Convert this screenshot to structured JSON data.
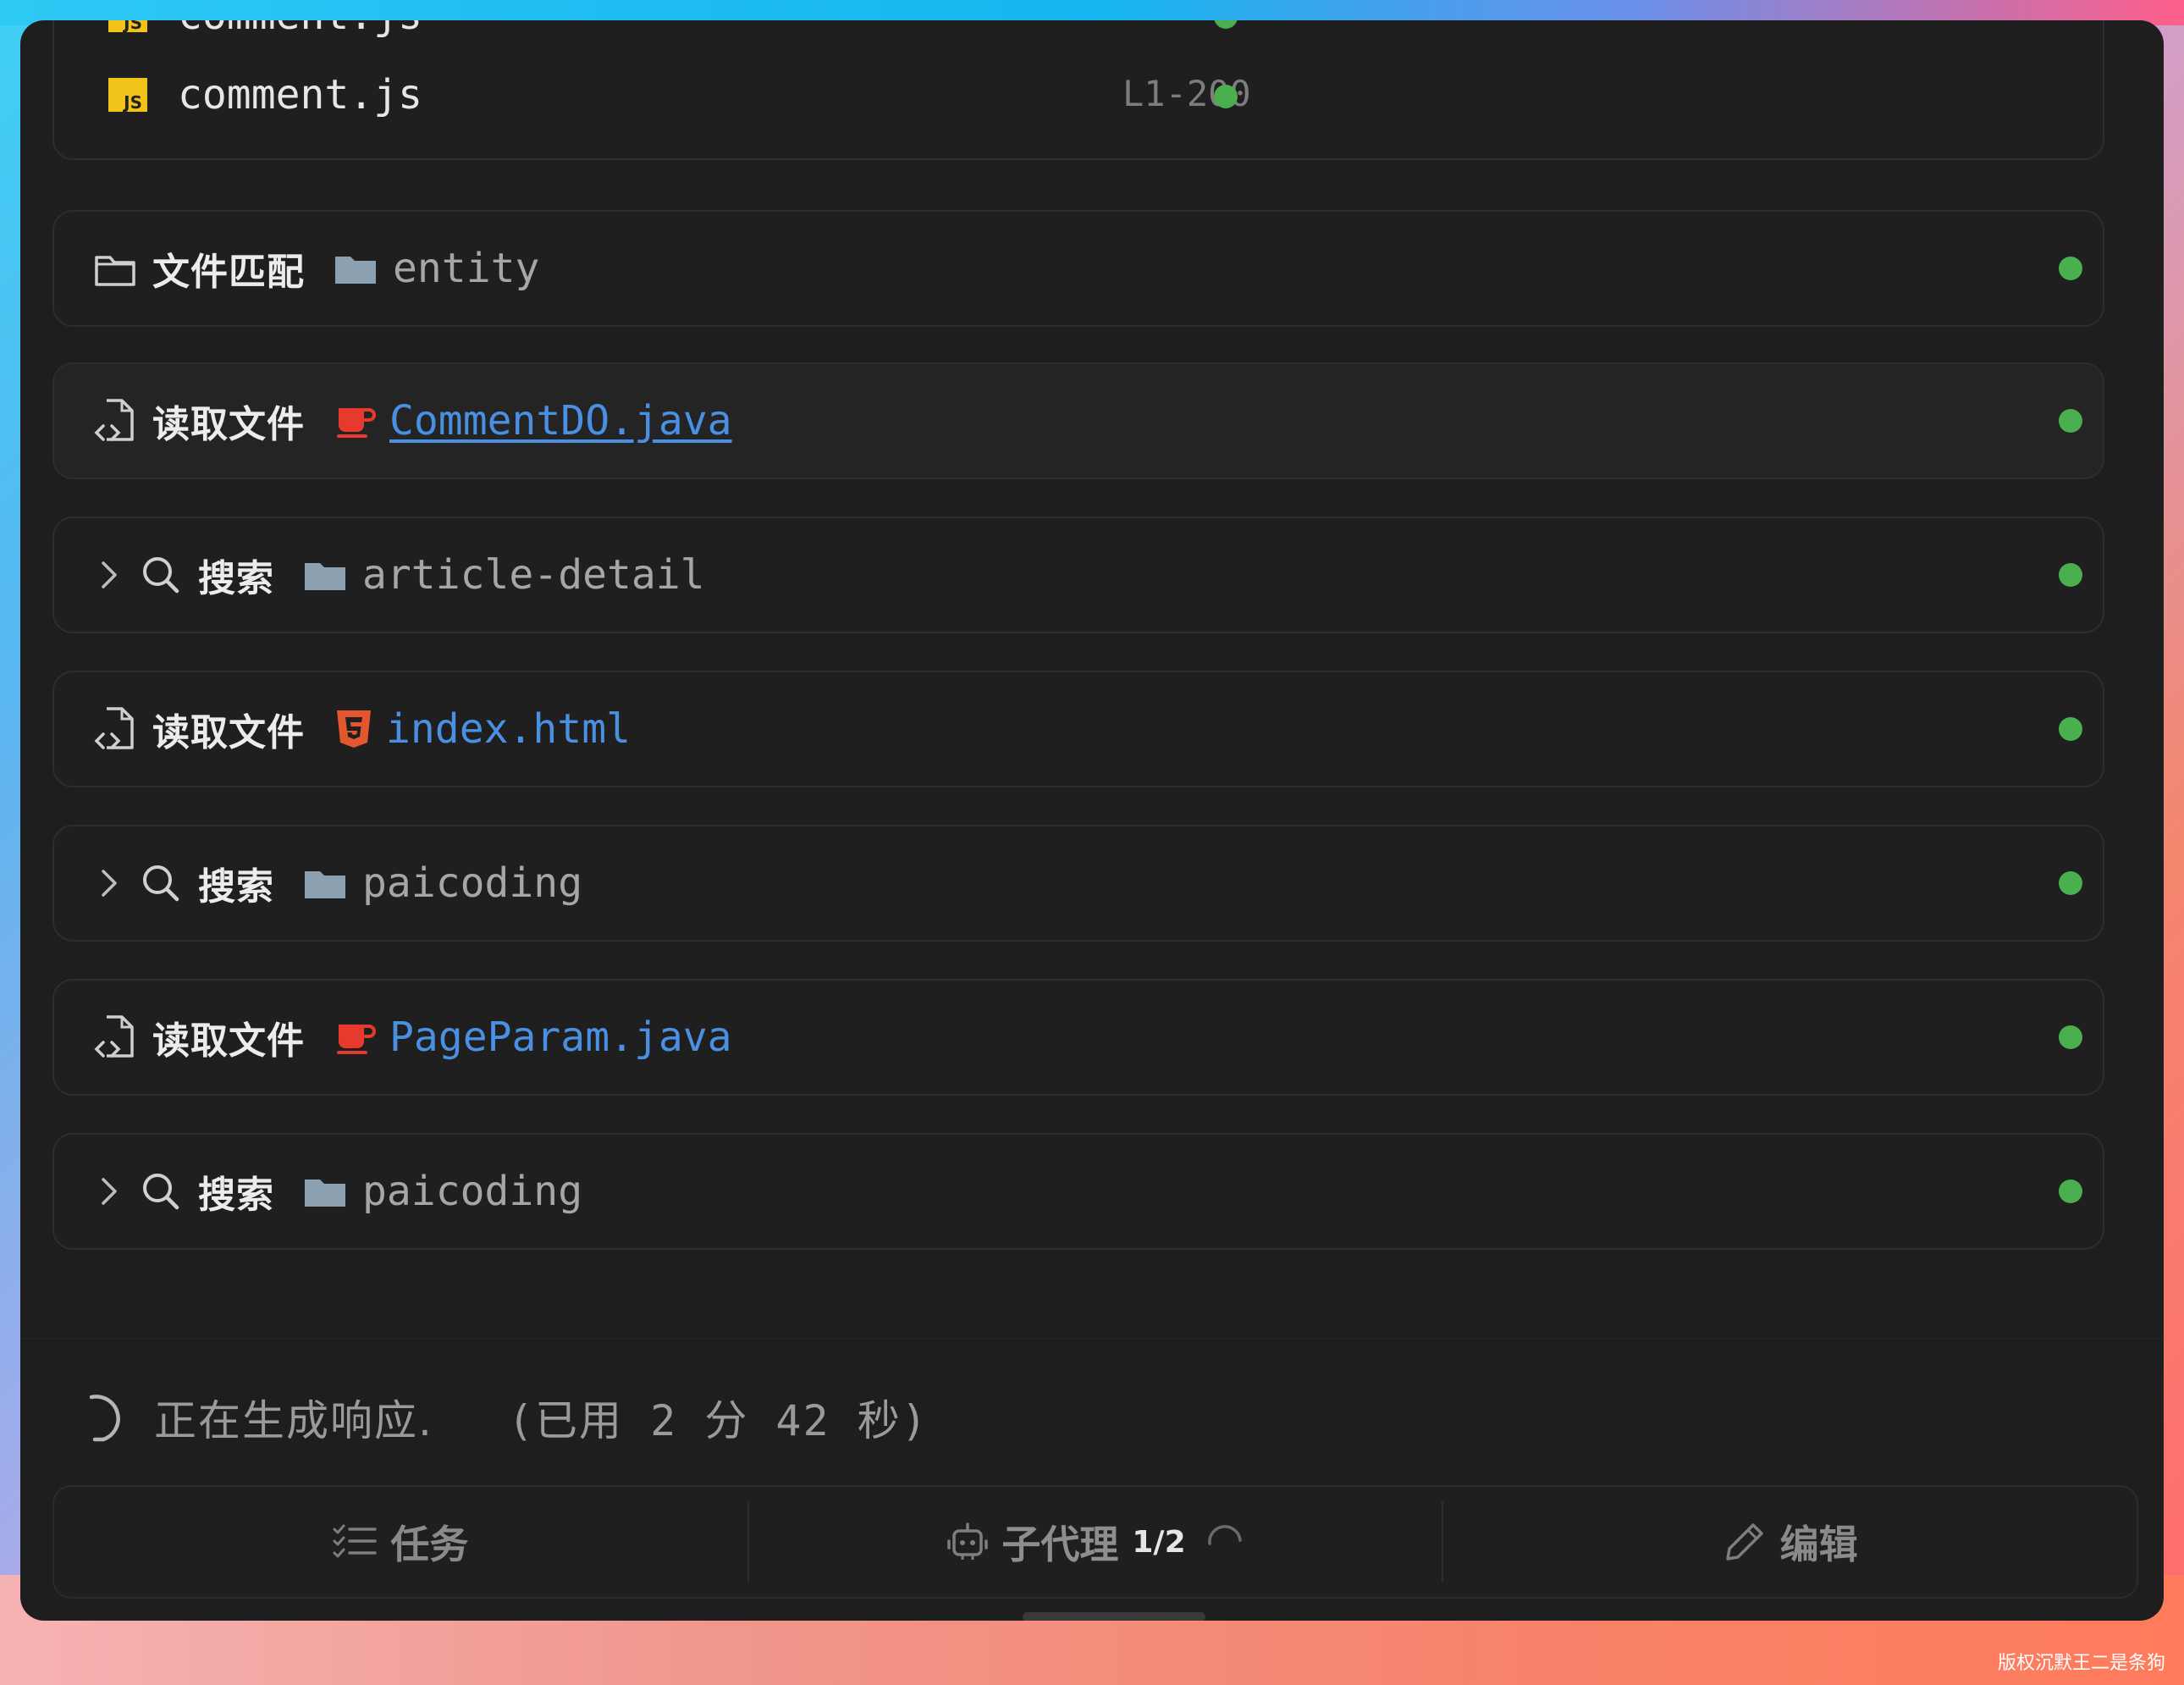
{
  "file_list": [
    {
      "name": "comment.js",
      "range": ""
    },
    {
      "name": "comment.js",
      "range": "L1-200"
    }
  ],
  "steps": [
    {
      "kind": "file-match",
      "action": "文件匹配",
      "target": "entity",
      "target_type": "folder",
      "expandable": false
    },
    {
      "kind": "read-file",
      "action": "读取文件",
      "target": "CommentDO.java",
      "target_type": "java",
      "expandable": false
    },
    {
      "kind": "search",
      "action": "搜索",
      "target": "article-detail",
      "target_type": "folder",
      "expandable": true
    },
    {
      "kind": "read-file",
      "action": "读取文件",
      "target": "index.html",
      "target_type": "html",
      "expandable": false
    },
    {
      "kind": "search",
      "action": "搜索",
      "target": "paicoding",
      "target_type": "folder",
      "expandable": true
    },
    {
      "kind": "read-file",
      "action": "读取文件",
      "target": "PageParam.java",
      "target_type": "java",
      "expandable": false
    },
    {
      "kind": "search",
      "action": "搜索",
      "target": "paicoding",
      "target_type": "folder",
      "expandable": true
    }
  ],
  "status": {
    "text": "正在生成响应.",
    "elapsed": "(已用 2 分 42 秒)"
  },
  "bottom_bar": {
    "tasks_label": "任务",
    "subagent_label": "子代理",
    "subagent_count": "1/2",
    "edit_label": "编辑"
  },
  "watermark": "版权沉默王二是条狗",
  "colors": {
    "status_dot": "#4ab04f",
    "link": "#4a90e2",
    "window_bg": "#1e1e1f"
  }
}
